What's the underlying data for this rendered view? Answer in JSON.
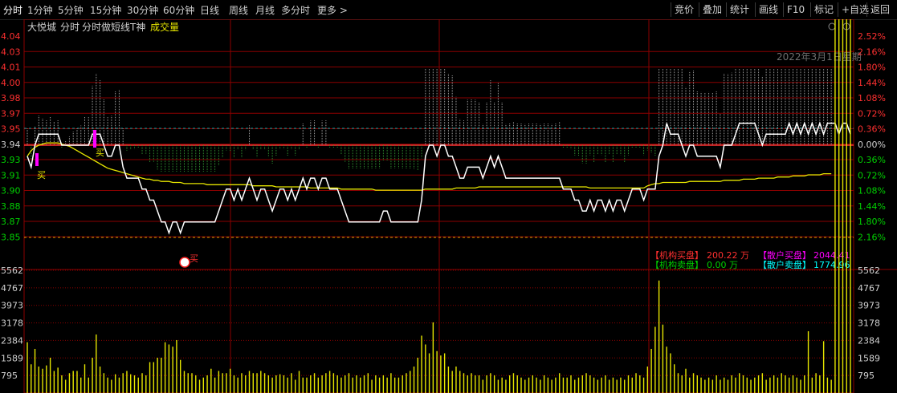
{
  "toolbar": {
    "period_tabs": [
      "分时",
      "1分钟",
      "5分钟",
      "15分钟",
      "30分钟",
      "60分钟",
      "日线",
      "周线",
      "月线",
      "多分时",
      "更多 >"
    ],
    "right_buttons": [
      "竞价",
      "叠加",
      "统计",
      "画线",
      "F10",
      "标记",
      "+自选",
      "返回"
    ]
  },
  "info": {
    "stock_name": "大悦城",
    "tabs": [
      "分时",
      "分时做短线T神",
      "成交量"
    ],
    "date_text": "2022年3月1日星期"
  },
  "markers": {
    "buy_label": "买"
  },
  "legend": {
    "inst_buy_label": "【机构买盘】",
    "inst_buy_value": "200.22 万",
    "inst_sell_label": "【机构卖盘】",
    "inst_sell_value": "0.00 万",
    "retail_buy_label": "【散户买盘】",
    "retail_buy_value": "2044.41",
    "retail_sell_label": "【散户卖盘】",
    "retail_sell_value": "1774.96"
  },
  "colors": {
    "background": "#000000",
    "grid": "#8b0000",
    "price_line": "#ffffff",
    "avg_line": "#e6e600",
    "up": "#ff3030",
    "down": "#00d000",
    "volume": "#e6e600",
    "magenta": "#ff00ff",
    "cyan": "#00ffff"
  },
  "chart_data": {
    "type": "line",
    "title": "大悦城",
    "prev_close": 3.94,
    "price_axis": {
      "ticks": [
        "4.04",
        "4.03",
        "4.01",
        "4.00",
        "3.98",
        "3.97",
        "3.95",
        "3.94",
        "3.93",
        "3.91",
        "3.90",
        "3.88",
        "3.87",
        "3.85"
      ],
      "pct_ticks": [
        "2.52%",
        "2.16%",
        "1.80%",
        "1.44%",
        "1.08%",
        "0.72%",
        "0.36%",
        "0.00%",
        "0.36%",
        "0.72%",
        "1.08%",
        "1.44%",
        "1.80%",
        "2.16%"
      ],
      "ylim": [
        3.8425,
        4.0393
      ]
    },
    "volume_axis": {
      "ticks": [
        "5562",
        "4767",
        "3973",
        "3178",
        "2384",
        "1589",
        "795"
      ],
      "ylim": [
        0,
        5562
      ]
    },
    "series": [
      {
        "name": "price",
        "values": [
          3.93,
          3.92,
          3.94,
          3.95,
          3.95,
          3.95,
          3.95,
          3.95,
          3.95,
          3.94,
          3.94,
          3.94,
          3.94,
          3.94,
          3.94,
          3.94,
          3.94,
          3.95,
          3.95,
          3.95,
          3.94,
          3.93,
          3.93,
          3.94,
          3.94,
          3.92,
          3.91,
          3.91,
          3.91,
          3.91,
          3.9,
          3.9,
          3.89,
          3.89,
          3.88,
          3.87,
          3.87,
          3.86,
          3.87,
          3.87,
          3.86,
          3.87,
          3.87,
          3.87,
          3.87,
          3.87,
          3.87,
          3.87,
          3.87,
          3.87,
          3.88,
          3.89,
          3.9,
          3.9,
          3.89,
          3.9,
          3.89,
          3.9,
          3.91,
          3.9,
          3.89,
          3.9,
          3.9,
          3.89,
          3.88,
          3.89,
          3.9,
          3.9,
          3.89,
          3.9,
          3.89,
          3.9,
          3.91,
          3.9,
          3.91,
          3.91,
          3.9,
          3.91,
          3.91,
          3.9,
          3.9,
          3.9,
          3.89,
          3.88,
          3.87,
          3.87,
          3.87,
          3.87,
          3.87,
          3.87,
          3.87,
          3.87,
          3.87,
          3.88,
          3.88,
          3.87,
          3.87,
          3.87,
          3.87,
          3.87,
          3.87,
          3.87,
          3.87,
          3.89,
          3.93,
          3.94,
          3.94,
          3.93,
          3.94,
          3.94,
          3.93,
          3.93,
          3.92,
          3.91,
          3.91,
          3.92,
          3.92,
          3.92,
          3.92,
          3.91,
          3.92,
          3.93,
          3.92,
          3.93,
          3.92,
          3.91,
          3.91,
          3.91,
          3.91,
          3.91,
          3.91,
          3.91,
          3.91,
          3.91,
          3.91,
          3.91,
          3.91,
          3.91,
          3.91,
          3.91,
          3.9,
          3.9,
          3.9,
          3.89,
          3.89,
          3.88,
          3.88,
          3.89,
          3.88,
          3.89,
          3.89,
          3.88,
          3.89,
          3.88,
          3.89,
          3.89,
          3.88,
          3.89,
          3.9,
          3.9,
          3.9,
          3.89,
          3.9,
          3.9,
          3.9,
          3.93,
          3.94,
          3.96,
          3.95,
          3.95,
          3.95,
          3.94,
          3.93,
          3.94,
          3.94,
          3.93,
          3.93,
          3.93,
          3.93,
          3.93,
          3.93,
          3.92,
          3.94,
          3.94,
          3.94,
          3.95,
          3.96,
          3.96,
          3.96,
          3.96,
          3.96,
          3.95,
          3.94,
          3.95,
          3.95,
          3.95,
          3.95,
          3.95,
          3.95,
          3.96,
          3.95,
          3.96,
          3.95,
          3.96,
          3.95,
          3.96,
          3.95,
          3.96,
          3.95,
          3.96,
          3.96,
          3.96,
          3.95,
          3.96,
          3.96,
          3.95
        ]
      },
      {
        "name": "avg",
        "values": [
          3.93,
          3.935,
          3.938,
          3.94,
          3.941,
          3.942,
          3.942,
          3.942,
          3.942,
          3.941,
          3.94,
          3.939,
          3.937,
          3.935,
          3.933,
          3.931,
          3.929,
          3.927,
          3.925,
          3.923,
          3.921,
          3.919,
          3.918,
          3.917,
          3.916,
          3.915,
          3.914,
          3.913,
          3.912,
          3.911,
          3.91,
          3.909,
          3.909,
          3.908,
          3.908,
          3.907,
          3.907,
          3.907,
          3.906,
          3.906,
          3.906,
          3.905,
          3.905,
          3.905,
          3.905,
          3.905,
          3.905,
          3.904,
          3.904,
          3.904,
          3.904,
          3.904,
          3.904,
          3.904,
          3.904,
          3.904,
          3.904,
          3.904,
          3.904,
          3.903,
          3.903,
          3.903,
          3.903,
          3.903,
          3.903,
          3.902,
          3.902,
          3.902,
          3.902,
          3.902,
          3.902,
          3.902,
          3.902,
          3.902,
          3.901,
          3.901,
          3.901,
          3.901,
          3.901,
          3.901,
          3.901,
          3.901,
          3.9,
          3.9,
          3.9,
          3.9,
          3.9,
          3.9,
          3.9,
          3.9,
          3.9,
          3.899,
          3.899,
          3.899,
          3.899,
          3.899,
          3.899,
          3.899,
          3.899,
          3.899,
          3.899,
          3.899,
          3.899,
          3.899,
          3.9,
          3.9,
          3.9,
          3.9,
          3.9,
          3.9,
          3.9,
          3.9,
          3.901,
          3.901,
          3.901,
          3.901,
          3.901,
          3.901,
          3.902,
          3.902,
          3.902,
          3.902,
          3.902,
          3.902,
          3.902,
          3.902,
          3.902,
          3.902,
          3.902,
          3.902,
          3.902,
          3.902,
          3.902,
          3.902,
          3.902,
          3.902,
          3.902,
          3.902,
          3.902,
          3.902,
          3.902,
          3.902,
          3.902,
          3.902,
          3.902,
          3.902,
          3.902,
          3.901,
          3.901,
          3.901,
          3.901,
          3.901,
          3.901,
          3.901,
          3.901,
          3.901,
          3.901,
          3.901,
          3.901,
          3.901,
          3.901,
          3.901,
          3.903,
          3.904,
          3.905,
          3.905,
          3.906,
          3.906,
          3.906,
          3.906,
          3.906,
          3.906,
          3.906,
          3.907,
          3.907,
          3.907,
          3.907,
          3.907,
          3.907,
          3.907,
          3.907,
          3.907,
          3.908,
          3.908,
          3.908,
          3.908,
          3.908,
          3.909,
          3.909,
          3.909,
          3.909,
          3.91,
          3.91,
          3.91,
          3.91,
          3.91,
          3.911,
          3.911,
          3.911,
          3.911,
          3.912,
          3.912,
          3.912,
          3.912,
          3.913,
          3.913,
          3.913,
          3.913,
          3.914,
          3.914,
          3.914
        ]
      },
      {
        "name": "volume",
        "values": [
          2300,
          1300,
          2000,
          1200,
          1100,
          1250,
          1600,
          1000,
          1150,
          800,
          600,
          900,
          1000,
          1000,
          700,
          1300,
          700,
          1600,
          2650,
          1200,
          900,
          700,
          600,
          850,
          700,
          900,
          1000,
          850,
          800,
          700,
          900,
          800,
          1400,
          1400,
          1600,
          1600,
          2300,
          2200,
          2100,
          2400,
          1500,
          1000,
          900,
          900,
          800,
          600,
          700,
          800,
          1100,
          700,
          1000,
          900,
          900,
          1100,
          800,
          700,
          900,
          800,
          1000,
          900,
          900,
          1000,
          900,
          800,
          700,
          800,
          850,
          800,
          700,
          900,
          600,
          1000,
          700,
          700,
          800,
          900,
          700,
          800,
          900,
          1000,
          900,
          800,
          700,
          800,
          900,
          700,
          800,
          700,
          800,
          900,
          600,
          800,
          700,
          800,
          700,
          900,
          700,
          700,
          800,
          900,
          1000,
          1200,
          1600,
          2600,
          2200,
          1800,
          3200,
          1900,
          1700,
          1800,
          1200,
          1000,
          1200,
          1000,
          900,
          800,
          900,
          800,
          800,
          600,
          800,
          900,
          800,
          600,
          700,
          600,
          800,
          900,
          800,
          700,
          600,
          700,
          800,
          700,
          600,
          800,
          700,
          600,
          700,
          900,
          700,
          700,
          800,
          600,
          700,
          800,
          900,
          800,
          700,
          600,
          700,
          800,
          600,
          700,
          600,
          700,
          600,
          800,
          700,
          900,
          800,
          700,
          1200,
          2000,
          3000,
          5100,
          3100,
          2100,
          1800,
          1300,
          900,
          800,
          1100,
          700,
          900,
          800,
          700,
          600,
          700,
          600,
          800,
          600,
          700,
          600,
          800,
          700,
          900,
          800,
          700,
          600,
          700,
          800,
          900,
          600,
          700,
          800,
          700,
          900,
          800,
          700,
          800,
          700,
          600,
          800,
          2800,
          700,
          900,
          800,
          2350,
          700,
          600
        ]
      }
    ]
  }
}
